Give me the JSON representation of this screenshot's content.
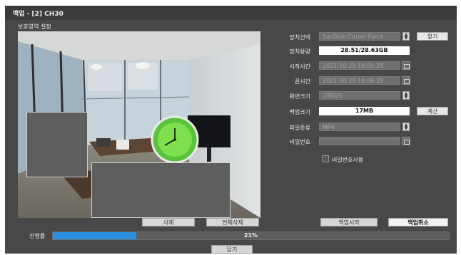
{
  "title": "백업 - [2] CH30",
  "section_label": "보호영역 설정",
  "form": {
    "device_label": "장치선택",
    "device_value": "SanDisk Cruzer Force",
    "find_button": "찾기",
    "capacity_label": "장치용량",
    "capacity_value": "28.51/28.63GB",
    "start_label": "시작시간",
    "start_value": "2021-10-29 10:05:28",
    "end_label": "끝시간",
    "end_value": "2021-10-29 10:06:28",
    "screen_size_label": "화면크기",
    "screen_size_value": "고해상도",
    "backup_size_label": "백업크기",
    "backup_size_value": "17MB",
    "calc_button": "계산",
    "file_type_label": "파일종류",
    "file_type_value": "MP4",
    "password_label": "비밀번호",
    "password_value": "",
    "use_password_label": "비밀번호사용",
    "use_password_checked": false
  },
  "buttons": {
    "delete": "삭제",
    "delete_all": "전체삭제",
    "start_backup": "백업시작",
    "cancel_backup": "백업취소",
    "close": "닫기"
  },
  "progress": {
    "label": "진행률",
    "percent_value": 0.21,
    "percent_text": "21%"
  },
  "colors": {
    "window_bg": "#484848",
    "titlebar_bg": "#3b3b3b",
    "progress_fill": "#2b8fe3"
  }
}
